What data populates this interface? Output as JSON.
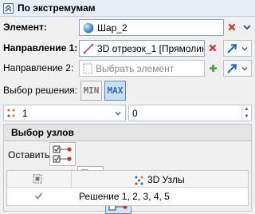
{
  "panel": {
    "title": "По экстремумам"
  },
  "element": {
    "label": "Элемент:",
    "value": "Шар_2",
    "value_icon": "sphere-icon",
    "actions": [
      "delete-icon",
      "chevron-down-icon"
    ]
  },
  "direction1": {
    "label": "Направление 1:",
    "value": "3D отрезок_1 [Прямолин...",
    "value_icon": "line-segment-icon",
    "actions": [
      "delete-icon",
      "direction-arrow-icon",
      "chevron-down-icon"
    ]
  },
  "direction2": {
    "label": "Направление 2:",
    "placeholder": "Выбрать элемент",
    "actions": [
      "add-icon",
      "direction-arrow-icon",
      "chevron-down-icon"
    ]
  },
  "solution_choice": {
    "label": "Выбор решения:",
    "options": [
      "MIN",
      "MAX"
    ],
    "selected": "MAX"
  },
  "count_selector": {
    "value": "1",
    "icon": "points-icon"
  },
  "number_field": {
    "value": "0"
  },
  "node_selection": {
    "title": "Выбор узлов",
    "keep_label": "Оставить:",
    "options": [
      "keep-all-icon",
      "keep-selected-icon",
      "keep-marked-icon"
    ],
    "selected_index": 2
  },
  "table": {
    "columns": [
      {
        "icon": "select-all-icon",
        "label": ""
      },
      {
        "icon": "nodes-3d-icon",
        "label": "3D Узлы"
      }
    ],
    "rows": [
      {
        "checked": true,
        "text": "Решение 1, 2, 3, 4, 5"
      }
    ]
  },
  "colors": {
    "accent": "#2f6db3",
    "delete": "#d22b2b",
    "add": "#3ca23c",
    "arrow": "#2a65b0",
    "header_bg": "#e6eef7"
  }
}
